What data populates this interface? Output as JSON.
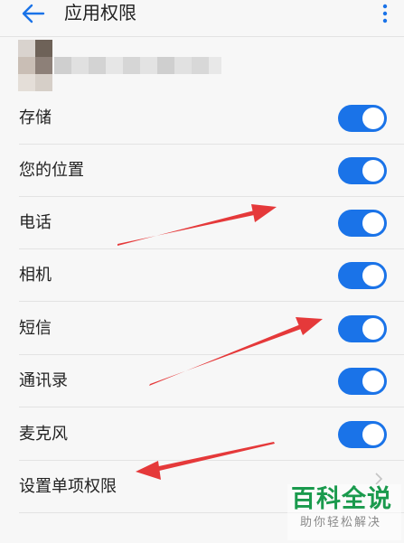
{
  "header": {
    "title": "应用权限",
    "back_icon": "arrow-left-icon",
    "more_icon": "more-vertical-icon"
  },
  "permissions": [
    {
      "label": "存储",
      "enabled": true
    },
    {
      "label": "您的位置",
      "enabled": true
    },
    {
      "label": "电话",
      "enabled": true
    },
    {
      "label": "相机",
      "enabled": true
    },
    {
      "label": "短信",
      "enabled": true
    },
    {
      "label": "通讯录",
      "enabled": true
    },
    {
      "label": "麦克风",
      "enabled": true
    }
  ],
  "single_item": {
    "label": "设置单项权限",
    "icon": "chevron-right-icon"
  },
  "watermark": {
    "brand": "百科全说",
    "tagline": "助你轻松解决"
  },
  "colors": {
    "accent": "#1a73e8",
    "annotation_arrow": "#e5393a",
    "watermark_green": "#1a9a4d"
  }
}
